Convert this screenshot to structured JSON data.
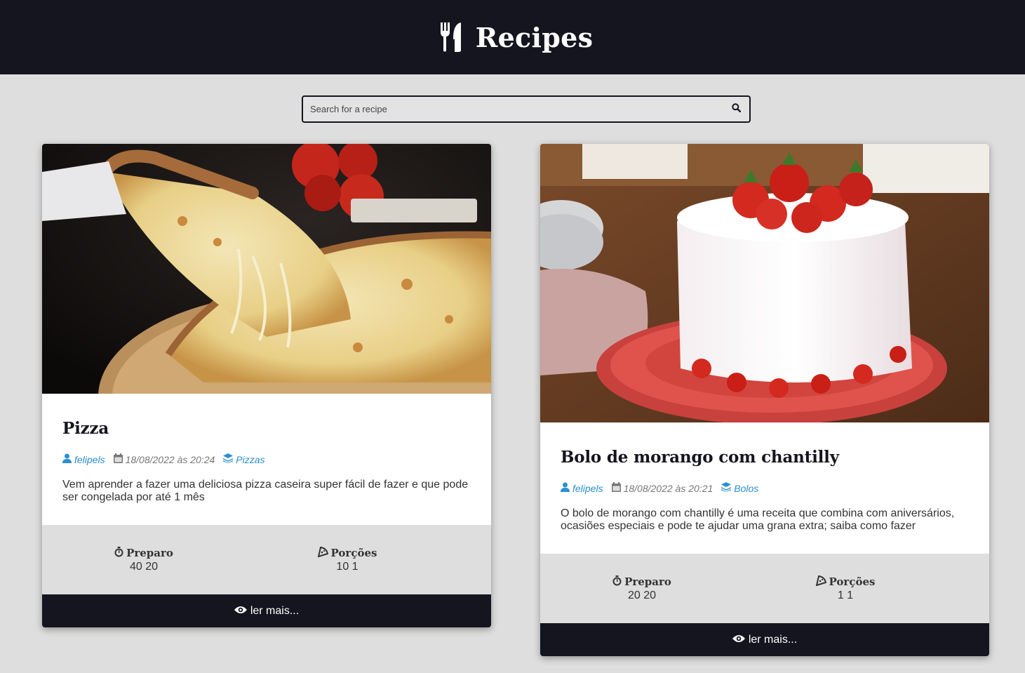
{
  "header": {
    "title": "Recipes",
    "logo_icon": "utensils-icon"
  },
  "search": {
    "placeholder": "Search for a recipe",
    "icon": "search-icon"
  },
  "colors": {
    "header_bg": "#151520",
    "accent": "#2a8fd0",
    "page_bg": "#dedede"
  },
  "recipes": [
    {
      "title": "Pizza",
      "image_icon": "pizza-photo",
      "author": "felipels",
      "date": "18/08/2022 às 20:24",
      "category": "Pizzas",
      "description": "Vem aprender a fazer uma deliciosa pizza caseira super fácil de fazer e que pode ser congelada por até 1 mês",
      "prep_label": "Preparo",
      "prep_value": "40 20",
      "servings_label": "Porções",
      "servings_value": "10 1",
      "read_more": "ler mais..."
    },
    {
      "title": "Bolo de morango com chantilly",
      "image_icon": "strawberry-cake-photo",
      "author": "felipels",
      "date": "18/08/2022 às 20:21",
      "category": "Bolos",
      "description": "O bolo de morango com chantilly é uma receita que combina com aniversários, ocasiões especiais e pode te ajudar uma grana extra; saiba como fazer",
      "prep_label": "Preparo",
      "prep_value": "20 20",
      "servings_label": "Porções",
      "servings_value": "1 1",
      "read_more": "ler mais..."
    }
  ]
}
